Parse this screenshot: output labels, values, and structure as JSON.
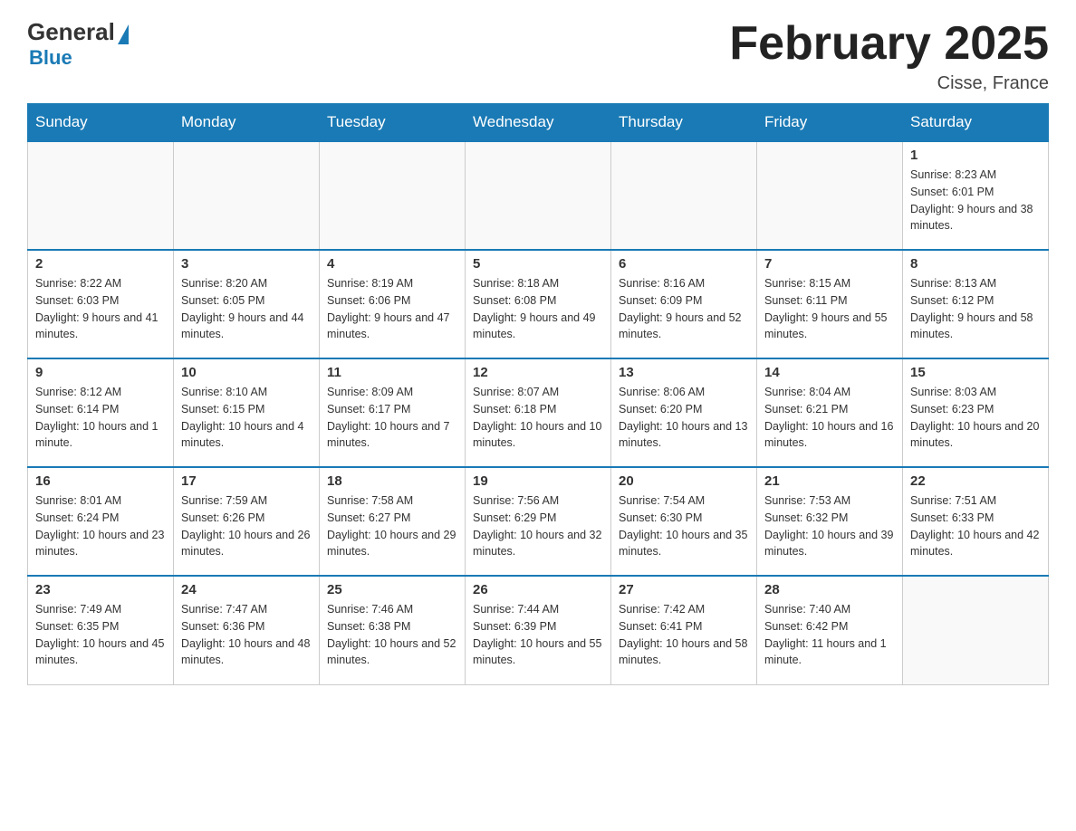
{
  "header": {
    "logo": {
      "general": "General",
      "blue": "Blue"
    },
    "title": "February 2025",
    "location": "Cisse, France"
  },
  "days_of_week": [
    "Sunday",
    "Monday",
    "Tuesday",
    "Wednesday",
    "Thursday",
    "Friday",
    "Saturday"
  ],
  "weeks": [
    [
      {
        "day": "",
        "info": ""
      },
      {
        "day": "",
        "info": ""
      },
      {
        "day": "",
        "info": ""
      },
      {
        "day": "",
        "info": ""
      },
      {
        "day": "",
        "info": ""
      },
      {
        "day": "",
        "info": ""
      },
      {
        "day": "1",
        "info": "Sunrise: 8:23 AM\nSunset: 6:01 PM\nDaylight: 9 hours and 38 minutes."
      }
    ],
    [
      {
        "day": "2",
        "info": "Sunrise: 8:22 AM\nSunset: 6:03 PM\nDaylight: 9 hours and 41 minutes."
      },
      {
        "day": "3",
        "info": "Sunrise: 8:20 AM\nSunset: 6:05 PM\nDaylight: 9 hours and 44 minutes."
      },
      {
        "day": "4",
        "info": "Sunrise: 8:19 AM\nSunset: 6:06 PM\nDaylight: 9 hours and 47 minutes."
      },
      {
        "day": "5",
        "info": "Sunrise: 8:18 AM\nSunset: 6:08 PM\nDaylight: 9 hours and 49 minutes."
      },
      {
        "day": "6",
        "info": "Sunrise: 8:16 AM\nSunset: 6:09 PM\nDaylight: 9 hours and 52 minutes."
      },
      {
        "day": "7",
        "info": "Sunrise: 8:15 AM\nSunset: 6:11 PM\nDaylight: 9 hours and 55 minutes."
      },
      {
        "day": "8",
        "info": "Sunrise: 8:13 AM\nSunset: 6:12 PM\nDaylight: 9 hours and 58 minutes."
      }
    ],
    [
      {
        "day": "9",
        "info": "Sunrise: 8:12 AM\nSunset: 6:14 PM\nDaylight: 10 hours and 1 minute."
      },
      {
        "day": "10",
        "info": "Sunrise: 8:10 AM\nSunset: 6:15 PM\nDaylight: 10 hours and 4 minutes."
      },
      {
        "day": "11",
        "info": "Sunrise: 8:09 AM\nSunset: 6:17 PM\nDaylight: 10 hours and 7 minutes."
      },
      {
        "day": "12",
        "info": "Sunrise: 8:07 AM\nSunset: 6:18 PM\nDaylight: 10 hours and 10 minutes."
      },
      {
        "day": "13",
        "info": "Sunrise: 8:06 AM\nSunset: 6:20 PM\nDaylight: 10 hours and 13 minutes."
      },
      {
        "day": "14",
        "info": "Sunrise: 8:04 AM\nSunset: 6:21 PM\nDaylight: 10 hours and 16 minutes."
      },
      {
        "day": "15",
        "info": "Sunrise: 8:03 AM\nSunset: 6:23 PM\nDaylight: 10 hours and 20 minutes."
      }
    ],
    [
      {
        "day": "16",
        "info": "Sunrise: 8:01 AM\nSunset: 6:24 PM\nDaylight: 10 hours and 23 minutes."
      },
      {
        "day": "17",
        "info": "Sunrise: 7:59 AM\nSunset: 6:26 PM\nDaylight: 10 hours and 26 minutes."
      },
      {
        "day": "18",
        "info": "Sunrise: 7:58 AM\nSunset: 6:27 PM\nDaylight: 10 hours and 29 minutes."
      },
      {
        "day": "19",
        "info": "Sunrise: 7:56 AM\nSunset: 6:29 PM\nDaylight: 10 hours and 32 minutes."
      },
      {
        "day": "20",
        "info": "Sunrise: 7:54 AM\nSunset: 6:30 PM\nDaylight: 10 hours and 35 minutes."
      },
      {
        "day": "21",
        "info": "Sunrise: 7:53 AM\nSunset: 6:32 PM\nDaylight: 10 hours and 39 minutes."
      },
      {
        "day": "22",
        "info": "Sunrise: 7:51 AM\nSunset: 6:33 PM\nDaylight: 10 hours and 42 minutes."
      }
    ],
    [
      {
        "day": "23",
        "info": "Sunrise: 7:49 AM\nSunset: 6:35 PM\nDaylight: 10 hours and 45 minutes."
      },
      {
        "day": "24",
        "info": "Sunrise: 7:47 AM\nSunset: 6:36 PM\nDaylight: 10 hours and 48 minutes."
      },
      {
        "day": "25",
        "info": "Sunrise: 7:46 AM\nSunset: 6:38 PM\nDaylight: 10 hours and 52 minutes."
      },
      {
        "day": "26",
        "info": "Sunrise: 7:44 AM\nSunset: 6:39 PM\nDaylight: 10 hours and 55 minutes."
      },
      {
        "day": "27",
        "info": "Sunrise: 7:42 AM\nSunset: 6:41 PM\nDaylight: 10 hours and 58 minutes."
      },
      {
        "day": "28",
        "info": "Sunrise: 7:40 AM\nSunset: 6:42 PM\nDaylight: 11 hours and 1 minute."
      },
      {
        "day": "",
        "info": ""
      }
    ]
  ]
}
